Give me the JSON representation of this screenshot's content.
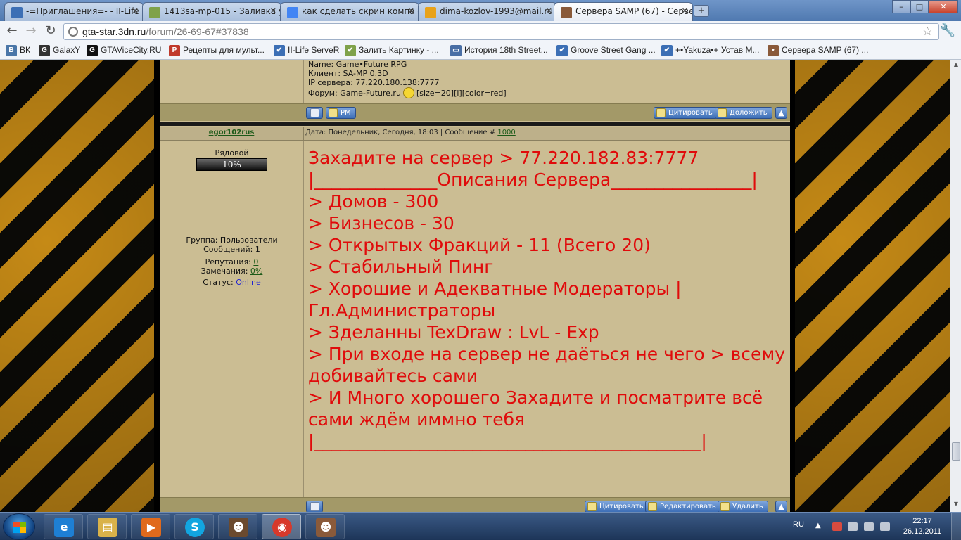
{
  "browser": {
    "tabs": [
      {
        "title": "-=Приглашения=- - II-Life",
        "favicon_color": "#3c6fb5"
      },
      {
        "title": "1413sa-mp-015 - Заливка у",
        "favicon_color": "#7fa24a"
      },
      {
        "title": "как сделать скрин компа -",
        "favicon_color": "#4285f4"
      },
      {
        "title": "dima-kozlov-1993@mail.ru",
        "favicon_color": "#e8a21a"
      },
      {
        "title": "Сервера SAMP (67) - Серве",
        "favicon_color": "#8a5a3a",
        "active": true
      }
    ],
    "new_tab_label": "+",
    "window_buttons": [
      "–",
      "□",
      "✕"
    ],
    "address": {
      "host": "gta-star.3dn.ru",
      "path": "/forum/26-69-67#37838"
    },
    "bookmarks": [
      {
        "label": "ВК",
        "icon": "vk-icon",
        "color": "#4a76a8",
        "glyph": "B"
      },
      {
        "label": "GalaxY",
        "icon": "galaxy-icon",
        "color": "#333333",
        "glyph": "G"
      },
      {
        "label": "GTAViceCity.RU",
        "icon": "gtavc-icon",
        "color": "#111111",
        "glyph": "G"
      },
      {
        "label": "Рецепты для мульт...",
        "icon": "recipes-icon",
        "color": "#c0392b",
        "glyph": "Р"
      },
      {
        "label": "II-Life ServeR",
        "icon": "iilife-icon",
        "color": "#3c6fb5",
        "glyph": "✔"
      },
      {
        "label": "Залить Картинку - ...",
        "icon": "upload-icon",
        "color": "#7fa24a",
        "glyph": "✔"
      },
      {
        "label": "История 18th Street...",
        "icon": "monitor-icon",
        "color": "#4a6fa5",
        "glyph": "▭"
      },
      {
        "label": "Groove Street Gang ...",
        "icon": "groove-icon",
        "color": "#3c6fb5",
        "glyph": "✔"
      },
      {
        "label": "+•Yakuza•+ Устав М...",
        "icon": "yakuza-icon",
        "color": "#3c6fb5",
        "glyph": "✔"
      },
      {
        "label": "Сервера SAMP (67) ...",
        "icon": "samp-icon",
        "color": "#8a5a3a",
        "glyph": "•"
      }
    ]
  },
  "prev_post": {
    "signature": [
      "Name: Game•Future RPG",
      "Клиент: SA-MP 0.3D",
      "IP сервера: 77.220.180.138:7777",
      "Форум: Game-Future.ru"
    ],
    "signature_tail": "[size=20][i][color=red]",
    "buttons": {
      "pm": "PM",
      "quote": "Цитировать",
      "report": "Доложить"
    }
  },
  "post": {
    "author": "egor102rus",
    "meta_prefix": "Дата: Понедельник, Сегодня, 18:03 | Сообщение #",
    "message_number": "1000",
    "user": {
      "rank": "Рядовой",
      "rank_progress": "10%",
      "group": "Группа: Пользователи",
      "messages": "Сообщений: 1",
      "reputation_label": "Репутация:",
      "reputation_value": "0",
      "warnings_label": "Замечания:",
      "warnings_value": "0%",
      "status_label": "Статус:",
      "status_value": "Online"
    },
    "body": [
      "Захадите на сервер > 77.220.182.83:7777",
      "",
      "|______________Описания Сервера________________|",
      "> Домов - 300",
      "> Бизнесов - 30",
      "> Открытых Фракций - 11 (Всего 20)",
      "> Стабильный Пинг",
      "> Хорошие и Адекватные Модераторы | Гл.Администраторы",
      "> Зделанны TexDraw : LvL - Exp",
      "> При входе на сервер не даёться не чего > всему добивайтесь сами",
      "> И Много хорошего Захадите и посматрите всё сами ждём иммно тебя",
      "|____________________________________________|"
    ],
    "buttons": {
      "quote": "Цитировать",
      "edit": "Редактировать",
      "delete": "Удалить"
    }
  },
  "taskbar": {
    "apps": [
      {
        "name": "taskbar-ie-icon",
        "glyph": "e",
        "color": "#1e7fd4"
      },
      {
        "name": "taskbar-explorer-icon",
        "glyph": "▤",
        "color": "#d9b24a"
      },
      {
        "name": "taskbar-mediaplayer-icon",
        "glyph": "▶",
        "color": "#e06a1c"
      },
      {
        "name": "taskbar-skype-icon",
        "glyph": "S",
        "color": "#12a5e0"
      },
      {
        "name": "taskbar-samp-icon",
        "glyph": "☻",
        "color": "#6b4a2e"
      },
      {
        "name": "taskbar-chrome-icon",
        "glyph": "◉",
        "color": "#d8392b",
        "active": true
      },
      {
        "name": "taskbar-samp2-icon",
        "glyph": "☻",
        "color": "#8a5a3a"
      }
    ],
    "language": "RU",
    "time": "22:17",
    "date": "26.12.2011"
  },
  "colors": {
    "post_text": "#e00b0b",
    "forum_bg": "#cbbd93",
    "action_bar": "#a39968",
    "link": "#1c5a18",
    "online": "#1f22d4"
  }
}
